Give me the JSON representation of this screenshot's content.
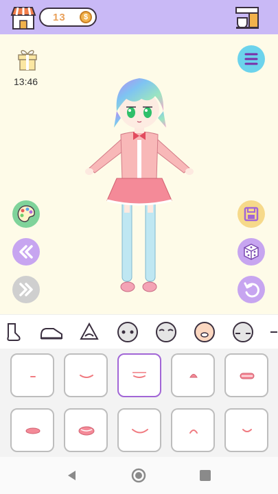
{
  "topbar": {
    "coins": "13",
    "coin_symbol": "$",
    "shop_icon": "shop-icon",
    "coffee_icon": "coffee-machine-icon",
    "colors": {
      "bar": "#c9b9f6",
      "coin_text": "#e9a05a"
    }
  },
  "stage": {
    "timer": "13:46",
    "gift_icon": "gift-icon",
    "left_buttons": [
      "palette-icon",
      "rewind-icon",
      "fast-forward-icon"
    ],
    "right_buttons": [
      "menu-icon",
      "save-icon",
      "dice-icon",
      "undo-icon"
    ]
  },
  "tabs": {
    "items": [
      "sock-icon",
      "shoe-icon",
      "nose-icon",
      "face-eyes-icon",
      "face-brows-icon",
      "face-mouth-icon",
      "face-blush-icon"
    ],
    "selected": "face-mouth-icon"
  },
  "mouth_grid": {
    "items": [
      "mouth-1",
      "mouth-2",
      "mouth-3",
      "mouth-4",
      "mouth-5",
      "mouth-6",
      "mouth-7",
      "mouth-8",
      "mouth-9",
      "mouth-10"
    ],
    "selected_index": 2,
    "accent": "#a165d6"
  },
  "navbar": {
    "buttons": [
      "back-icon",
      "home-icon",
      "recents-icon"
    ]
  }
}
